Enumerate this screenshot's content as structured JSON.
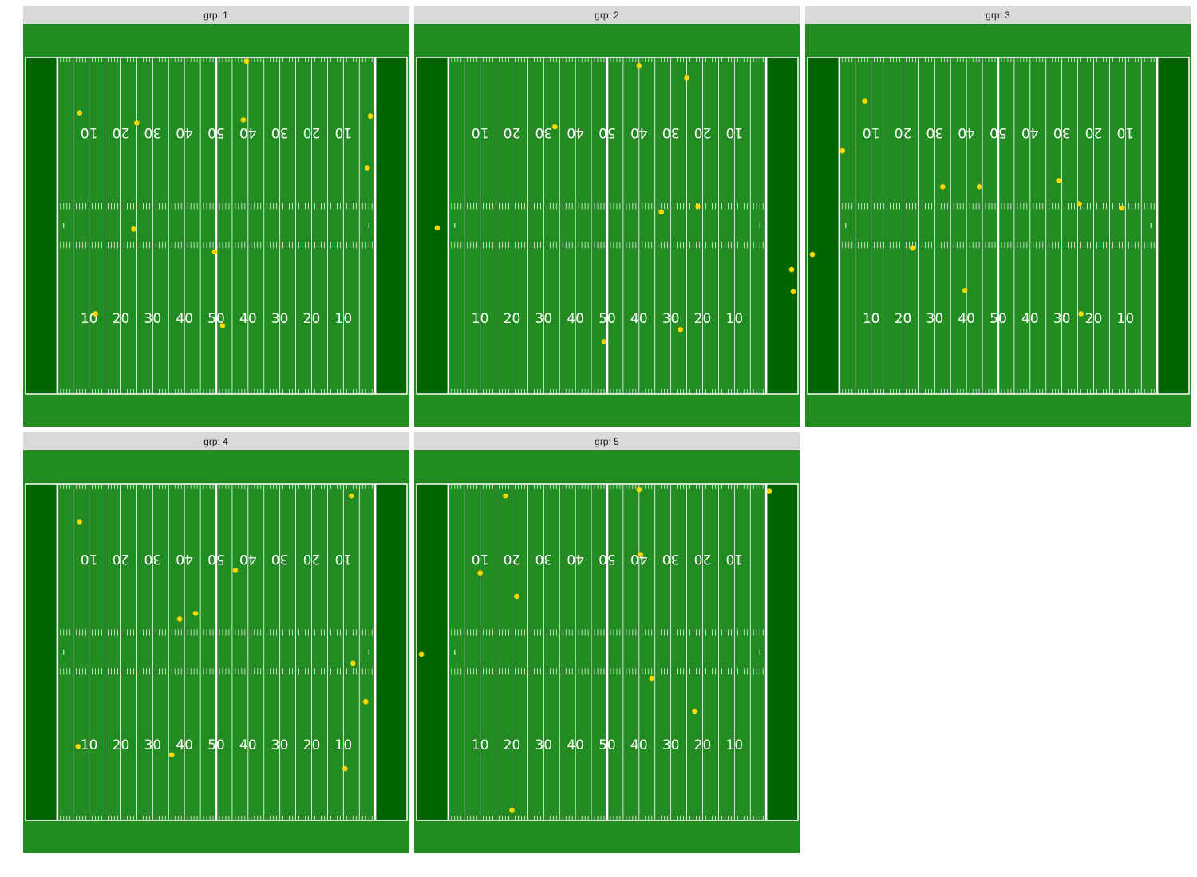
{
  "facet_variable": "grp",
  "panels": [
    {
      "strip": "grp: 1"
    },
    {
      "strip": "grp: 2"
    },
    {
      "strip": "grp: 3"
    },
    {
      "strip": "grp: 4"
    },
    {
      "strip": "grp: 5"
    }
  ],
  "colors": {
    "field": "#228b22",
    "endzone": "#006400",
    "lines": "#ffffff",
    "point": "#ffd700",
    "strip": "#d9d9d9"
  },
  "chart_data": {
    "type": "scatter",
    "facet": "grp",
    "xlim": [
      0,
      120
    ],
    "ylim": [
      0,
      53.3
    ],
    "yard_numbers_bottom": [
      "10",
      "20",
      "30",
      "40",
      "50",
      "40",
      "30",
      "20",
      "10"
    ],
    "yard_numbers_top": [
      "10",
      "20",
      "30",
      "40",
      "50",
      "40",
      "30",
      "20",
      "10"
    ],
    "series": [
      {
        "grp": "1",
        "points": [
          {
            "x": 17,
            "y": 44.5
          },
          {
            "x": 35,
            "y": 42.9
          },
          {
            "x": 69.5,
            "y": 52.7
          },
          {
            "x": 68.5,
            "y": 43.4
          },
          {
            "x": 108.5,
            "y": 44
          },
          {
            "x": 107.5,
            "y": 35.8
          },
          {
            "x": 34,
            "y": 26.1
          },
          {
            "x": 59.5,
            "y": 22.5
          },
          {
            "x": 22,
            "y": 12.7
          },
          {
            "x": 62,
            "y": 10.8
          }
        ]
      },
      {
        "grp": "2",
        "points": [
          {
            "x": 70,
            "y": 52
          },
          {
            "x": 85,
            "y": 50.1
          },
          {
            "x": 43.5,
            "y": 42.3
          },
          {
            "x": 77,
            "y": 28.8
          },
          {
            "x": 88.5,
            "y": 29.7
          },
          {
            "x": 6.5,
            "y": 26.3
          },
          {
            "x": 118,
            "y": 19.7
          },
          {
            "x": 118.5,
            "y": 16.2
          },
          {
            "x": 83,
            "y": 10.2
          },
          {
            "x": 59,
            "y": 8.3
          }
        ]
      },
      {
        "grp": "3",
        "points": [
          {
            "x": 18,
            "y": 46.4
          },
          {
            "x": 11,
            "y": 38.5
          },
          {
            "x": 54,
            "y": 32.8
          },
          {
            "x": 79,
            "y": 33.8
          },
          {
            "x": 42.5,
            "y": 32.8
          },
          {
            "x": 99,
            "y": 29.4
          },
          {
            "x": 85.5,
            "y": 30.1
          },
          {
            "x": 1.5,
            "y": 22.1
          },
          {
            "x": 33,
            "y": 23.1
          },
          {
            "x": 49.5,
            "y": 16.4
          },
          {
            "x": 86,
            "y": 12.7
          }
        ]
      },
      {
        "grp": "4",
        "points": [
          {
            "x": 102.5,
            "y": 51.4
          },
          {
            "x": 17,
            "y": 47.3
          },
          {
            "x": 66,
            "y": 39.6
          },
          {
            "x": 48.5,
            "y": 31.9
          },
          {
            "x": 53.5,
            "y": 32.8
          },
          {
            "x": 103,
            "y": 24.9
          },
          {
            "x": 107,
            "y": 18.8
          },
          {
            "x": 16.5,
            "y": 11.7
          },
          {
            "x": 46,
            "y": 10.4
          },
          {
            "x": 100.5,
            "y": 8.2
          }
        ]
      },
      {
        "grp": "5",
        "points": [
          {
            "x": 70,
            "y": 52.4
          },
          {
            "x": 111,
            "y": 52.2
          },
          {
            "x": 28,
            "y": 51.4
          },
          {
            "x": 70.5,
            "y": 42.1
          },
          {
            "x": 20,
            "y": 39.2
          },
          {
            "x": 31.5,
            "y": 35.5
          },
          {
            "x": 1.5,
            "y": 26.3
          },
          {
            "x": 74,
            "y": 22.5
          },
          {
            "x": 87.5,
            "y": 17.3
          },
          {
            "x": 30,
            "y": 1.6
          }
        ]
      }
    ]
  }
}
